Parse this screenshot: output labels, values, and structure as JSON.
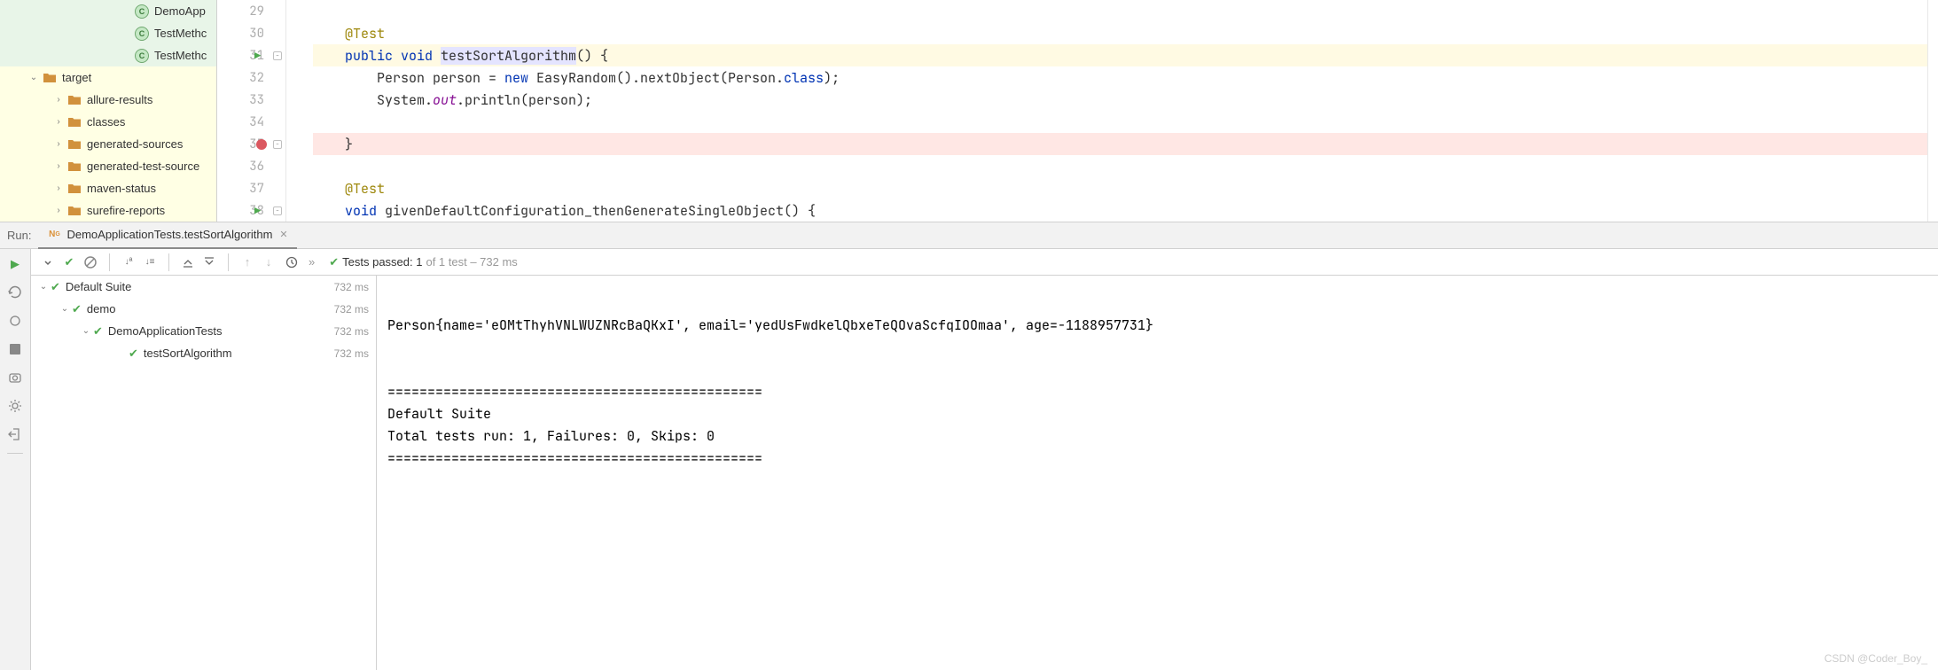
{
  "project_tree": {
    "class_items": [
      {
        "label": "DemoApp",
        "indent": 150
      },
      {
        "label": "TestMethc",
        "indent": 150
      },
      {
        "label": "TestMethc",
        "indent": 150
      }
    ],
    "target_folder": {
      "label": "target",
      "indent": 30,
      "expanded": true
    },
    "target_children": [
      {
        "label": "allure-results",
        "indent": 58
      },
      {
        "label": "classes",
        "indent": 58
      },
      {
        "label": "generated-sources",
        "indent": 58
      },
      {
        "label": "generated-test-source",
        "indent": 58
      },
      {
        "label": "maven-status",
        "indent": 58
      },
      {
        "label": "surefire-reports",
        "indent": 58
      }
    ]
  },
  "editor": {
    "lines": [
      {
        "n": 29,
        "tokens": []
      },
      {
        "n": 30,
        "tokens": [
          {
            "t": "    ",
            "c": ""
          },
          {
            "t": "@Test",
            "c": "ann"
          }
        ]
      },
      {
        "n": 31,
        "run": true,
        "fold": true,
        "hl": "hl-yellow",
        "tokens": [
          {
            "t": "    ",
            "c": ""
          },
          {
            "t": "public void ",
            "c": "kw"
          },
          {
            "t": "testSortAlgorithm",
            "c": "sel"
          },
          {
            "t": "() {",
            "c": ""
          }
        ]
      },
      {
        "n": 32,
        "tokens": [
          {
            "t": "        Person person = ",
            "c": ""
          },
          {
            "t": "new ",
            "c": "kw"
          },
          {
            "t": "EasyRandom().nextObject(Person.",
            "c": ""
          },
          {
            "t": "class",
            "c": "kw"
          },
          {
            "t": ");",
            "c": ""
          }
        ]
      },
      {
        "n": 33,
        "tokens": [
          {
            "t": "        System.",
            "c": ""
          },
          {
            "t": "out",
            "c": "field-italic"
          },
          {
            "t": ".println(person);",
            "c": ""
          }
        ]
      },
      {
        "n": 34,
        "tokens": []
      },
      {
        "n": 35,
        "bp": true,
        "fold": true,
        "hl": "hl-red",
        "tokens": [
          {
            "t": "    }",
            "c": ""
          }
        ]
      },
      {
        "n": 36,
        "tokens": []
      },
      {
        "n": 37,
        "tokens": [
          {
            "t": "    ",
            "c": ""
          },
          {
            "t": "@Test",
            "c": "ann"
          }
        ]
      },
      {
        "n": 38,
        "run": true,
        "fold": true,
        "tokens": [
          {
            "t": "    ",
            "c": ""
          },
          {
            "t": "void ",
            "c": "kw"
          },
          {
            "t": "givenDefaultConfiguration_thenGenerateSingleObject() {",
            "c": ""
          }
        ]
      }
    ]
  },
  "run": {
    "header_label": "Run:",
    "tab_label": "DemoApplicationTests.testSortAlgorithm",
    "status_prefix": "Tests passed: 1",
    "status_suffix": " of 1 test – 732 ms",
    "tree": [
      {
        "label": "Default Suite",
        "time": "732 ms",
        "indent": 6,
        "chev": true
      },
      {
        "label": "demo",
        "time": "732 ms",
        "indent": 30,
        "chev": true
      },
      {
        "label": "DemoApplicationTests",
        "time": "732 ms",
        "indent": 54,
        "chev": true
      },
      {
        "label": "testSortAlgorithm",
        "time": "732 ms",
        "indent": 94,
        "chev": false
      }
    ],
    "console": "Person{name='eOMtThyhVNLWUZNRcBaQKxI', email='yedUsFwdkelQbxeTeQOvaScfqIOOmaa', age=-1188957731}\n\n\n===============================================\nDefault Suite\nTotal tests run: 1, Failures: 0, Skips: 0\n==============================================="
  },
  "watermark": "CSDN @Coder_Boy_"
}
